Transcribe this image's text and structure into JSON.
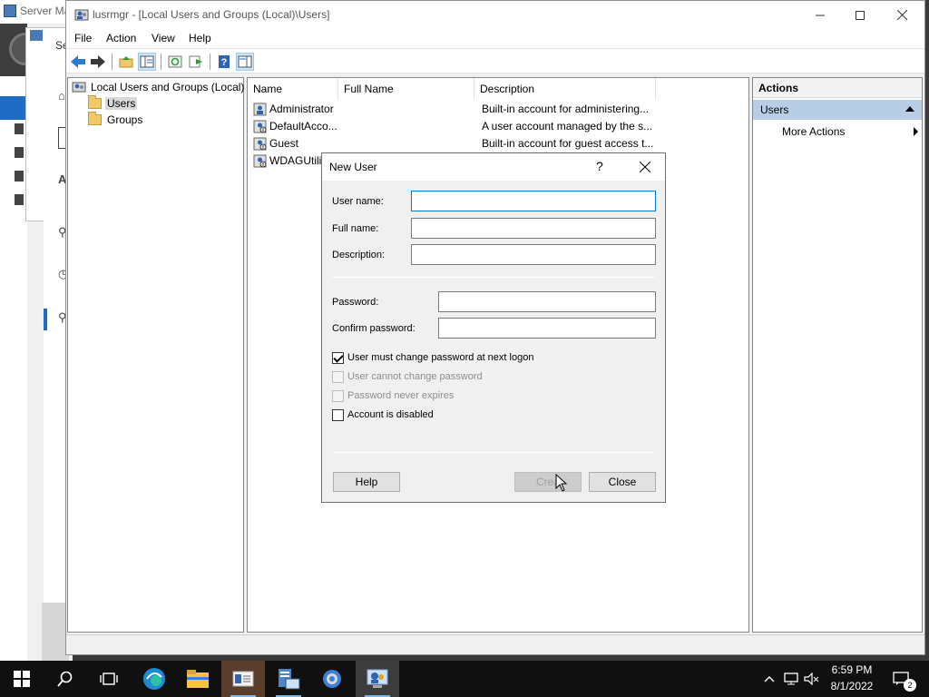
{
  "background_window": {
    "title": "Server Ma",
    "inner_title": "Se",
    "marks": [
      "A"
    ]
  },
  "window": {
    "title": "lusrmgr - [Local Users and Groups (Local)\\Users]",
    "controls": [
      "minimize",
      "maximize",
      "close"
    ]
  },
  "menu": [
    "File",
    "Action",
    "View",
    "Help"
  ],
  "toolbar": {
    "icons": [
      "back-arrow-icon",
      "forward-arrow-icon",
      "up-folder-icon",
      "show-hide-tree-icon",
      "refresh-icon",
      "export-list-icon",
      "help-icon",
      "show-hide-action-pane-icon"
    ]
  },
  "tree": {
    "root": "Local Users and Groups (Local)",
    "children": [
      "Users",
      "Groups"
    ],
    "selected": "Users"
  },
  "list": {
    "columns": [
      "Name",
      "Full Name",
      "Description"
    ],
    "rows": [
      {
        "name": "Administrator",
        "full_name": "",
        "description": "Built-in account for administering..."
      },
      {
        "name": "DefaultAcco...",
        "full_name": "",
        "description": "A user account managed by the s..."
      },
      {
        "name": "Guest",
        "full_name": "",
        "description": "Built-in account for guest access t..."
      },
      {
        "name": "WDAGUtilit",
        "full_name": "",
        "description": ""
      }
    ]
  },
  "actions": {
    "header": "Actions",
    "section": "Users",
    "items": [
      "More Actions"
    ]
  },
  "dialog": {
    "title": "New User",
    "help_glyph": "?",
    "fields": {
      "username": {
        "label": "User name:",
        "value": ""
      },
      "fullname": {
        "label": "Full name:",
        "value": ""
      },
      "description": {
        "label": "Description:",
        "value": ""
      },
      "password": {
        "label": "Password:",
        "value": ""
      },
      "confirm": {
        "label": "Confirm password:",
        "value": ""
      }
    },
    "checkboxes": [
      {
        "label": "User must change password at next logon",
        "checked": true,
        "enabled": true
      },
      {
        "label": "User cannot change password",
        "checked": false,
        "enabled": false
      },
      {
        "label": "Password never expires",
        "checked": false,
        "enabled": false
      },
      {
        "label": "Account is disabled",
        "checked": false,
        "enabled": true
      }
    ],
    "buttons": {
      "help": "Help",
      "create": "Crea",
      "close": "Close"
    }
  },
  "taskbar": {
    "apps": [
      "start-icon",
      "search-icon",
      "task-view-icon",
      "edge-icon",
      "file-explorer-icon",
      "lusrmgr-icon",
      "server-manager-icon",
      "settings-icon",
      "computer-management-icon"
    ],
    "time": "6:59 PM",
    "date": "8/1/2022",
    "notifications": "2"
  },
  "colors": {
    "selection_blue": "#1f6cc4",
    "actions_section": "#b8cde6",
    "focus_border": "#0078d7"
  }
}
